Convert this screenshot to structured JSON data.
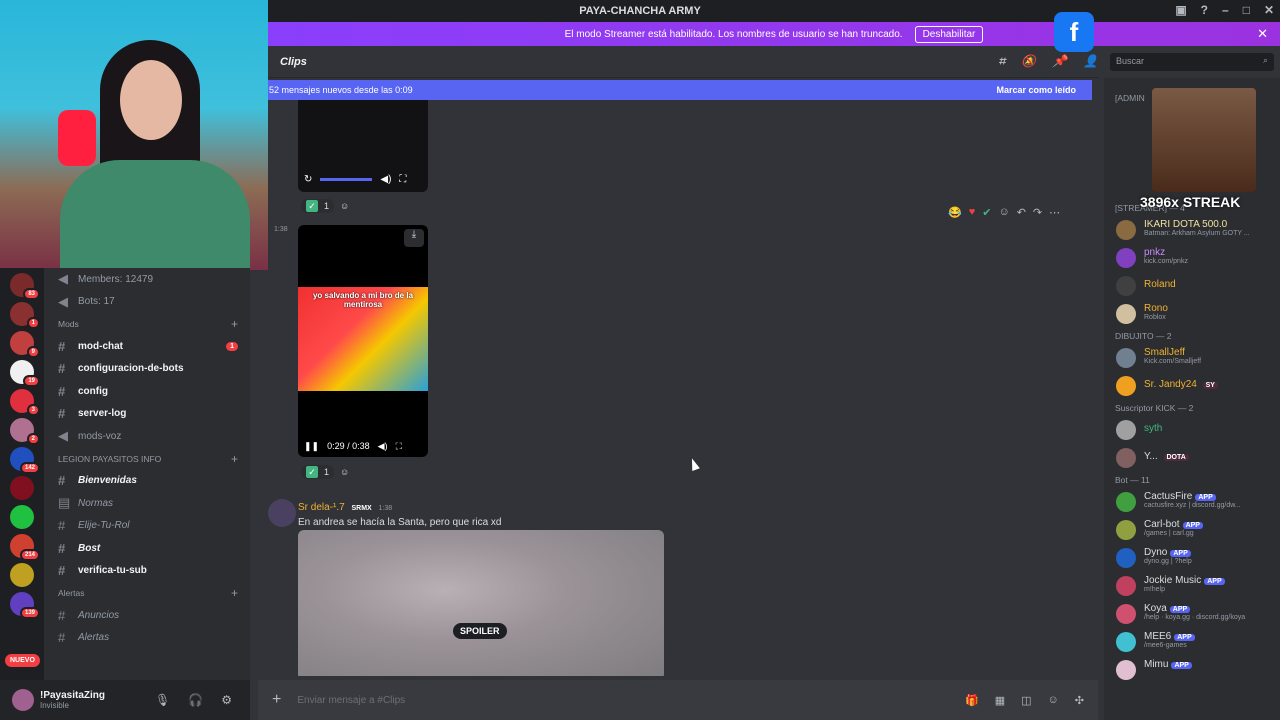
{
  "window": {
    "title": "PAYA-CHANCHA ARMY"
  },
  "banner": {
    "text": "El modo Streamer está habilitado. Los nombres de usuario se han truncado.",
    "button": "Deshabilitar"
  },
  "overlay": {
    "streak": "3896x STREAK",
    "facebook": "f"
  },
  "servers": {
    "badges": [
      "83",
      "1",
      "9",
      "19",
      "3",
      "2",
      "142",
      "214",
      "139"
    ],
    "new_label": "NUEVO"
  },
  "channels": {
    "voice_top": [
      {
        "label": "Members: 12479"
      },
      {
        "label": "Bots: 17"
      }
    ],
    "cat_mods": "Mods",
    "mods": [
      {
        "label": "mod-chat",
        "badge": "1",
        "bold": true
      },
      {
        "label": "configuracion-de-bots",
        "bold": true
      },
      {
        "label": "config",
        "bold": true
      },
      {
        "label": "server-log",
        "bold": true
      },
      {
        "label": "mods-voz",
        "bold": false
      }
    ],
    "cat_legion": "LEGION PAYASITOS INFO",
    "legion": [
      {
        "label": "Bienvenidas",
        "bold": true
      },
      {
        "label": "Normas",
        "bold": false
      },
      {
        "label": "Elije-Tu-Rol",
        "bold": false
      },
      {
        "label": "Bost",
        "bold": true
      },
      {
        "label": "verifica-tu-sub",
        "bold": true
      }
    ],
    "cat_alertas": "Alertas",
    "alertas": [
      {
        "label": "Anuncios"
      },
      {
        "label": "Alertas"
      }
    ]
  },
  "user": {
    "name": "!PayasitaZing",
    "status": "Invisible"
  },
  "chat": {
    "header": "Clips",
    "search_placeholder": "Buscar",
    "new_messages": "52 mensajes nuevos desde las 0:09",
    "mark_read": "Marcar como leído",
    "reaction_count": "1",
    "video2": {
      "caption": "yo salvando a mi bro de la mentirosa",
      "time": "0:29 / 0:38"
    },
    "time_138": "1:38",
    "message3": {
      "author": "Sr dela-¹.7",
      "tag": "SRMX",
      "time": "1:38",
      "text": "En andrea se hacía la Santa, pero que rica xd",
      "spoiler": "SPOILER"
    },
    "composer_placeholder": "Enviar mensaje a #Clips"
  },
  "members": {
    "cat_admin": "[ADMIN",
    "cat_streamer": "[STREAMER] — 4",
    "streamers": [
      {
        "name": "IKARI DOTA 500.0",
        "sub": "Batman: Arkham Asylum GOTY ...",
        "color": "#f0e0a0"
      },
      {
        "name": "pnkz",
        "sub": "kick.com/pnkz",
        "color": "#c88cff"
      },
      {
        "name": "Roland",
        "sub": "",
        "color": "#f0b232"
      },
      {
        "name": "Rono",
        "sub": "Roblox",
        "color": "#f0b232"
      }
    ],
    "cat_dibujito": "DIBUJITO — 2",
    "dibujito": [
      {
        "name": "SmallJeff",
        "sub": "Kick.com/Smalljeff",
        "color": "#f0b232"
      },
      {
        "name": "Sr. Jandy24",
        "sub": "",
        "color": "#f0b232"
      }
    ],
    "cat_kick": "Suscriptor KICK — 2",
    "kick": [
      {
        "name": "syth",
        "sub": "",
        "color": "#43b581"
      },
      {
        "name": "Y...",
        "sub": "",
        "color": "#dbdee1"
      }
    ],
    "cat_bot": "Bot — 11",
    "bots": [
      {
        "name": "CactusFire",
        "sub": "cactusfire.xyz | discord.gg/dw..."
      },
      {
        "name": "Carl-bot",
        "sub": "/games | carl.gg"
      },
      {
        "name": "Dyno",
        "sub": "dyno.gg | ?help"
      },
      {
        "name": "Jockie Music",
        "sub": "m!help"
      },
      {
        "name": "Koya",
        "sub": "/help · koya.gg · discord.gg/koya"
      },
      {
        "name": "MEE6",
        "sub": "/mee6-games"
      },
      {
        "name": "Mimu",
        "sub": ""
      }
    ],
    "app_label": "APP",
    "dota_tag": "DOTA",
    "sy_tag": "SY"
  }
}
